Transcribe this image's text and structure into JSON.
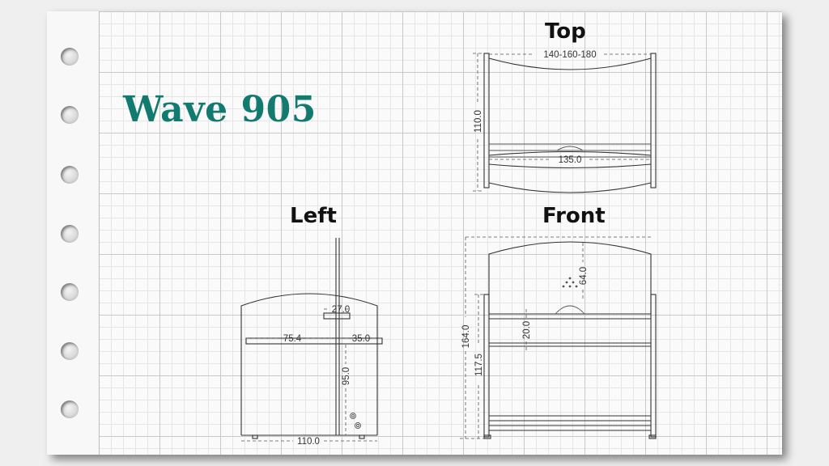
{
  "title": "Wave 905",
  "views": {
    "top": {
      "label": "Top",
      "dims": {
        "width_range": "140-160-180",
        "depth": "110.0",
        "inner_width": "135.0"
      }
    },
    "left": {
      "label": "Left",
      "dims": {
        "arm": "27.0",
        "back_offset": "75.4",
        "front_offset": "35.0",
        "height": "95.0",
        "depth": "110.0"
      }
    },
    "front": {
      "label": "Front",
      "dims": {
        "headboard_peak": "64.0",
        "rail_gap": "20.0",
        "total_height": "164.0",
        "side_height": "117.5"
      }
    }
  },
  "colors": {
    "title": "#137a70",
    "lines": "#333333",
    "paper": "#fafafa",
    "background": "#efefef"
  }
}
